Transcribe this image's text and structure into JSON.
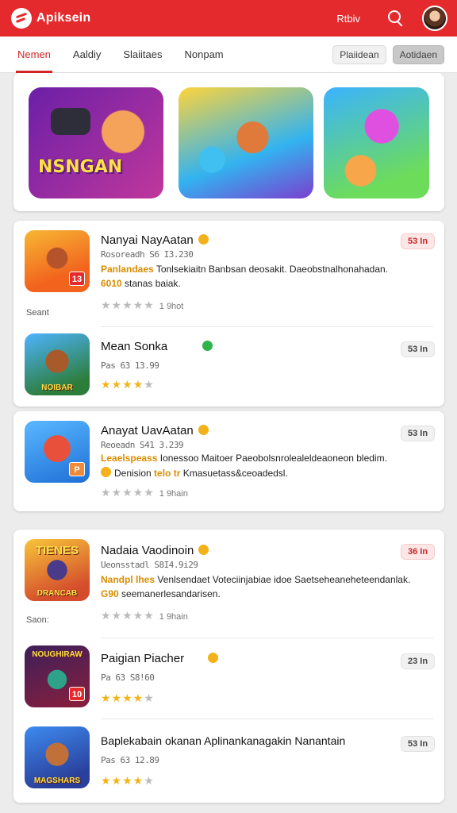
{
  "header": {
    "title": "Apiksein",
    "link": "Rtbiv",
    "search_icon": "search-icon",
    "accent_color": "#e42a2c"
  },
  "tabs": [
    {
      "label": "Nemen",
      "active": true
    },
    {
      "label": "Aaldiy",
      "active": false
    },
    {
      "label": "Slaiitaes",
      "active": false
    },
    {
      "label": "Nonpam",
      "active": false
    }
  ],
  "chips": {
    "left": "Plaiidean",
    "right": "Aotidaen"
  },
  "banners": {
    "first_text": "NSNGAN"
  },
  "list1": {
    "item1": {
      "title": "Nanyai NayAatan",
      "meta": "Rosoreadh  S6 I3.230",
      "desc1_hl": "Panlandaes",
      "desc1": "Tonlsekiaitn Banbsan deosakit. Daeobstnalhonahadan.",
      "desc2_hl": "6010",
      "desc2": "stanas baiak.",
      "rating_count": "1 9hot",
      "side_label": "Seant",
      "price": "53 In",
      "icon_badge": "13"
    },
    "item2": {
      "title": "Mean Sonka",
      "meta": "Pas 63  13.99",
      "price": "53 In",
      "icon_text": "NOIBAR"
    }
  },
  "list2": {
    "item1": {
      "title": "Anayat UavAatan",
      "meta": "Reoeadn  S41 3.239",
      "desc1_hl": "Leaelspeass",
      "desc1": "Ionessoo Maitoer Paeobolsnrolealeldeaoneon bledim.",
      "desc2_hl": "telo tr",
      "desc2_pre": "Denision",
      "desc2": "Kmasuetass&ceoadedsl.",
      "rating_count": "1 9hain",
      "price": "53 In"
    }
  },
  "list3": {
    "item1": {
      "title": "Nadaia Vaodinoin",
      "meta": "Ueonsstadl  S8I4.9i29",
      "desc1_hl": "Nandpl lhes",
      "desc1": "Venlsendaet Voteciinjabiae idoe Saetseheaneheteendanlak.",
      "desc2_hl": "G90",
      "desc2": "seemanerlesandarisen.",
      "rating_count": "1 9hain",
      "side_label": "Saon:",
      "price": "36 In",
      "icon_top": "TIENES",
      "icon_text": "DRANCAB"
    },
    "item2": {
      "title": "Paigian Piacher",
      "meta": "Pa 63  S8!60",
      "price": "23 In",
      "icon_top": "NOUGHIRAW",
      "icon_badge": "10"
    },
    "item3": {
      "title": "Baplekabain okanan Aplinankanagakin Nanantain",
      "meta": "Pas 63  12.89",
      "price": "53 In",
      "icon_text": "MAGSHARS"
    }
  }
}
